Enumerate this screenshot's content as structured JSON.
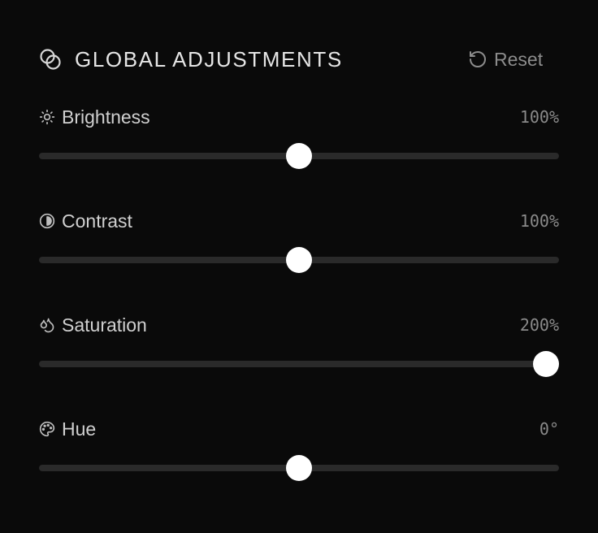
{
  "panel": {
    "title": "GLOBAL ADJUSTMENTS",
    "title_icon": "circles-overlap-icon",
    "reset_label": "Reset",
    "reset_icon": "rotate-ccw-icon"
  },
  "controls": [
    {
      "label": "Brightness",
      "value": "100%",
      "icon": "sun-icon",
      "min": 0,
      "max": 200,
      "current": 100
    },
    {
      "label": "Contrast",
      "value": "100%",
      "icon": "contrast-icon",
      "min": 0,
      "max": 200,
      "current": 100
    },
    {
      "label": "Saturation",
      "value": "200%",
      "icon": "droplets-icon",
      "min": 0,
      "max": 200,
      "current": 200
    },
    {
      "label": "Hue",
      "value": "0°",
      "icon": "palette-icon",
      "min": -180,
      "max": 180,
      "current": 0
    }
  ],
  "colors": {
    "background": "#0a0a0a",
    "track": "#2a2a2a",
    "thumb": "#ffffff",
    "title": "#e6e6e6",
    "muted": "#8a8a8a"
  }
}
